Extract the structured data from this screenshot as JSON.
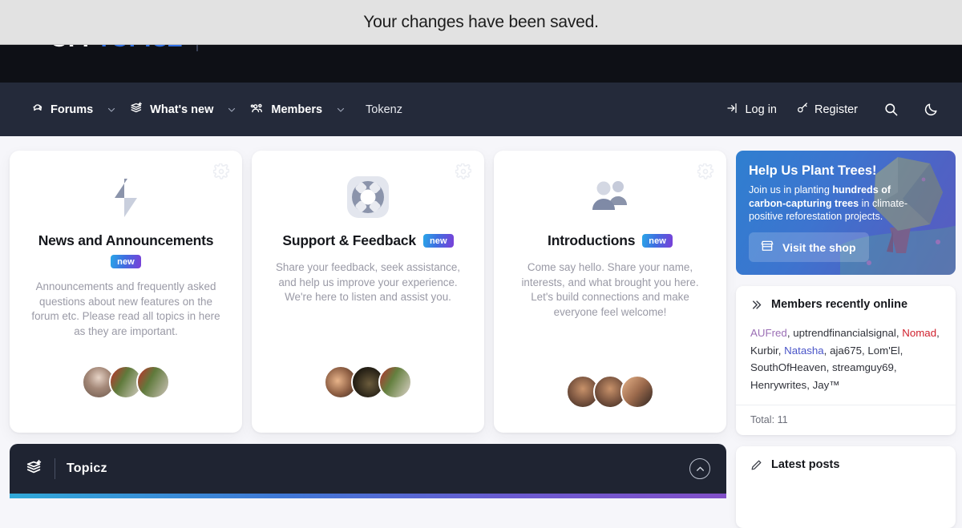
{
  "toast": {
    "message": "Your changes have been saved."
  },
  "brand": {
    "name_part1": "OFF",
    "name_part2": "TOPICZ"
  },
  "nav": {
    "items": [
      {
        "label": "Forums",
        "icon": "forums-icon",
        "has_caret": true
      },
      {
        "label": "What's new",
        "icon": "whats-new-icon",
        "has_caret": true
      },
      {
        "label": "Members",
        "icon": "members-icon",
        "has_caret": true
      },
      {
        "label": "Tokenz",
        "icon": "",
        "has_caret": false
      }
    ],
    "login_label": "Log in",
    "register_label": "Register",
    "search_icon": "search-icon",
    "theme_icon": "moon-icon"
  },
  "cards": [
    {
      "title": "News and Announcements",
      "badge": "new",
      "badge_stacked": true,
      "icon": "lightning-bolt-icon",
      "description": "Announcements and frequently asked questions about new features on the forum etc. Please read all topics in here as they are important."
    },
    {
      "title": "Support & Feedback",
      "badge": "new",
      "badge_stacked": false,
      "icon": "lifebuoy-icon",
      "description": "Share your feedback, seek assistance, and help us improve your experience. We're here to listen and assist you."
    },
    {
      "title": "Introductions",
      "badge": "new",
      "badge_stacked": false,
      "icon": "people-icon",
      "description": "Come say hello. Share your name, interests, and what brought you here. Let's build connections and make everyone feel welcome!"
    }
  ],
  "topicz": {
    "title": "Topicz",
    "logo_icon": "topicz-stack-icon",
    "collapse_icon": "chevron-up-icon"
  },
  "promo": {
    "title": "Help Us Plant Trees!",
    "text_before": "Join us in planting ",
    "text_bold": "hundreds of carbon-capturing trees",
    "text_after": " in climate-positive reforestation projects.",
    "button_label": "Visit the shop",
    "button_icon": "shop-icon"
  },
  "members_online": {
    "title": "Members recently online",
    "title_icon": "double-chevron-right-icon",
    "members": [
      {
        "name": "AUFred",
        "color": "#9b6fb5"
      },
      {
        "name": "uptrendfinancialsignal",
        "color": "#30323a"
      },
      {
        "name": "Nomad",
        "color": "#d0212e"
      },
      {
        "name": "Kurbir",
        "color": "#30323a"
      },
      {
        "name": "Natasha",
        "color": "#4a55c8"
      },
      {
        "name": "aja675",
        "color": "#30323a"
      },
      {
        "name": "Lom'El",
        "color": "#30323a"
      },
      {
        "name": "SouthOfHeaven",
        "color": "#30323a"
      },
      {
        "name": "streamguy69",
        "color": "#30323a"
      },
      {
        "name": "Henrywrites",
        "color": "#30323a"
      },
      {
        "name": "Jay™",
        "color": "#30323a"
      }
    ],
    "total_label": "Total: 11"
  },
  "latest_posts": {
    "title": "Latest posts",
    "icon": "pencil-icon"
  },
  "colors": {
    "accent_blue": "#2f6fe4",
    "nav_bg": "#242a3a",
    "header_bg": "#0e1016",
    "page_bg": "#f6f6fa",
    "badge_gradient_start": "#2aa7e8",
    "badge_gradient_end": "#7b3fd8"
  }
}
